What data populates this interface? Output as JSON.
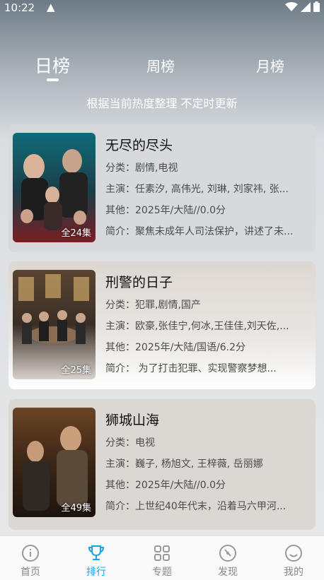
{
  "status": {
    "time": "10:22",
    "alert": "▲"
  },
  "tabs": {
    "day": "日榜",
    "week": "周榜",
    "month": "月榜"
  },
  "subtitle": "根据当前热度整理 不定时更新",
  "items": [
    {
      "title": "无尽的尽头",
      "category": "分类：剧情,电视",
      "cast": "主演：任素汐, 高伟光, 刘琳, 刘家祎, 张...",
      "other": "其他：2025年/大陆//0.0分",
      "intro": "简介：聚焦未成年人司法保护，讲述了未...",
      "episodes": "全24集"
    },
    {
      "title": "刑警的日子",
      "category": "分类：犯罪,剧情,国产",
      "cast": "主演：欧豪,张佳宁,何冰,王佳佳,刘天佐,...",
      "other": "其他：2025年/大陆/国语/6.2分",
      "intro": "简介：       为了打击犯罪、实现警察梦想...",
      "episodes": "全25集"
    },
    {
      "title": "狮城山海",
      "category": "分类：电视",
      "cast": "主演：巍子, 杨旭文, 王梓薇, 岳丽娜",
      "other": "其他：2025年/大陆//0.0分",
      "intro": "简介：上世纪40年代末，沿着马六甲河...",
      "episodes": "全49集"
    }
  ],
  "nav": {
    "home": "首页",
    "rank": "排行",
    "topic": "专题",
    "discover": "发现",
    "mine": "我的"
  },
  "colors": {
    "accent": "#1da1e6"
  }
}
